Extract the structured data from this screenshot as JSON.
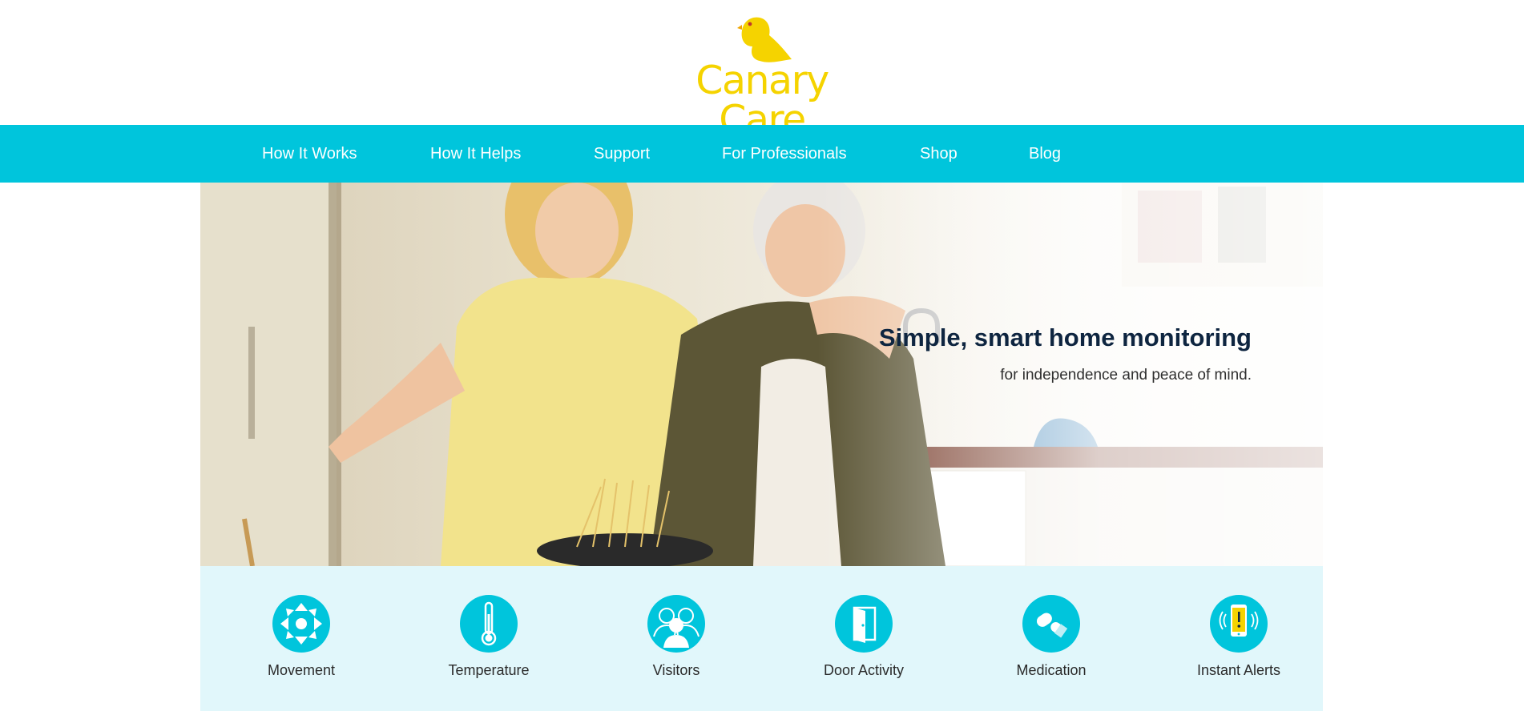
{
  "logo": {
    "text": "Canary Care",
    "color": "#f5d300"
  },
  "nav": {
    "background": "#00c5dc",
    "items": [
      {
        "label": "How It Works"
      },
      {
        "label": "How It Helps"
      },
      {
        "label": "Support"
      },
      {
        "label": "For Professionals"
      },
      {
        "label": "Shop"
      },
      {
        "label": "Blog"
      }
    ]
  },
  "hero": {
    "title": "Simple, smart home monitoring",
    "subtitle": "for independence and peace of mind."
  },
  "features": {
    "background": "#e1f7fb",
    "items": [
      {
        "label": "Movement",
        "icon": "movement-arrows-icon"
      },
      {
        "label": "Temperature",
        "icon": "thermometer-icon"
      },
      {
        "label": "Visitors",
        "icon": "visitors-people-icon"
      },
      {
        "label": "Door Activity",
        "icon": "open-door-icon"
      },
      {
        "label": "Medication",
        "icon": "pills-icon"
      },
      {
        "label": "Instant Alerts",
        "icon": "phone-alert-icon"
      }
    ]
  }
}
